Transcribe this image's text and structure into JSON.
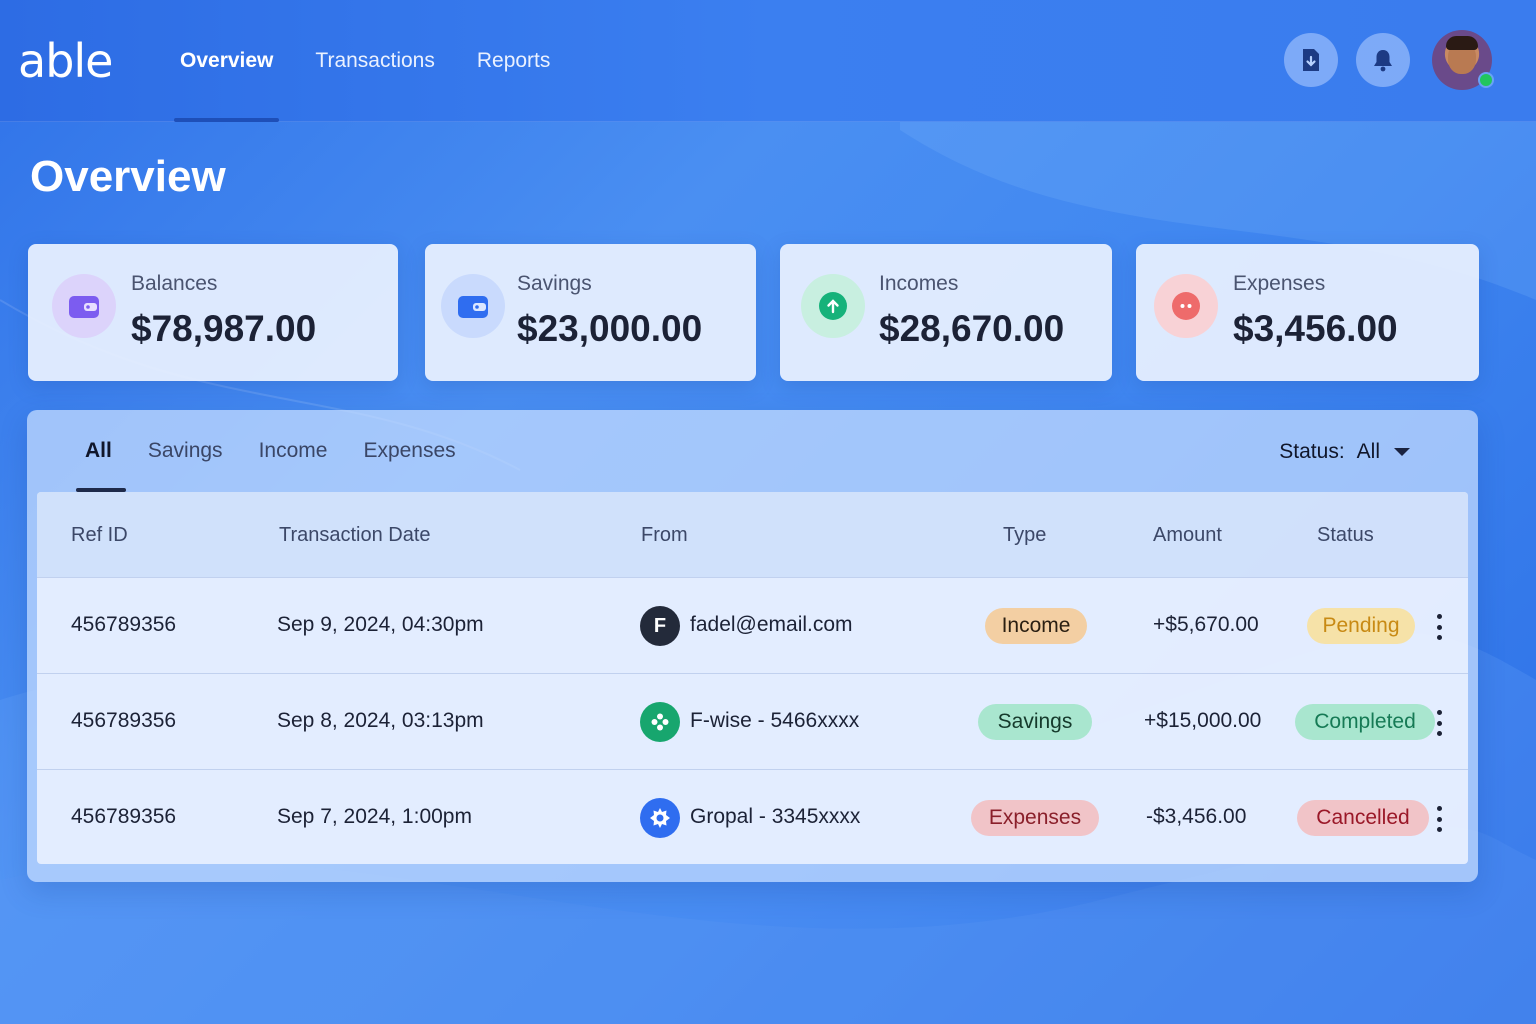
{
  "app": {
    "logo": "able"
  },
  "nav": {
    "items": [
      {
        "label": "Overview",
        "active": true
      },
      {
        "label": "Transactions",
        "active": false
      },
      {
        "label": "Reports",
        "active": false
      }
    ]
  },
  "header_icons": [
    "download-document-icon",
    "bell-icon",
    "avatar"
  ],
  "page": {
    "title": "Overview"
  },
  "cards": [
    {
      "label": "Balances",
      "value": "$78,987.00",
      "icon": "wallet-icon",
      "color": "#7c5cf0"
    },
    {
      "label": "Savings",
      "value": "$23,000.00",
      "icon": "wallet-icon",
      "color": "#2f6df0"
    },
    {
      "label": "Incomes",
      "value": "$28,670.00",
      "icon": "arrow-up-icon",
      "color": "#16b27a"
    },
    {
      "label": "Expenses",
      "value": "$3,456.00",
      "icon": "dots-icon",
      "color": "#ee6b6b"
    }
  ],
  "tabs": [
    {
      "label": "All",
      "active": true
    },
    {
      "label": "Savings",
      "active": false
    },
    {
      "label": "Income",
      "active": false
    },
    {
      "label": "Expenses",
      "active": false
    }
  ],
  "status_filter": {
    "label": "Status:",
    "value": "All"
  },
  "table": {
    "headers": [
      "Ref ID",
      "Transaction Date",
      "From",
      "Type",
      "Amount",
      "Status"
    ],
    "rows": [
      {
        "ref": "456789356",
        "date": "Sep 9, 2024, 04:30pm",
        "from_initial": "F",
        "from": "fadel@email.com",
        "type": "Income",
        "amount": "+$5,670.00",
        "status": "Pending"
      },
      {
        "ref": "456789356",
        "date": "Sep 8, 2024, 03:13pm",
        "from_initial": "",
        "from": "F-wise - 5466xxxx",
        "type": "Savings",
        "amount": "+$15,000.00",
        "status": "Completed"
      },
      {
        "ref": "456789356",
        "date": "Sep 7, 2024, 1:00pm",
        "from_initial": "",
        "from": "Gropal - 3345xxxx",
        "type": "Expenses",
        "amount": "-$3,456.00",
        "status": "Cancelled"
      }
    ]
  }
}
